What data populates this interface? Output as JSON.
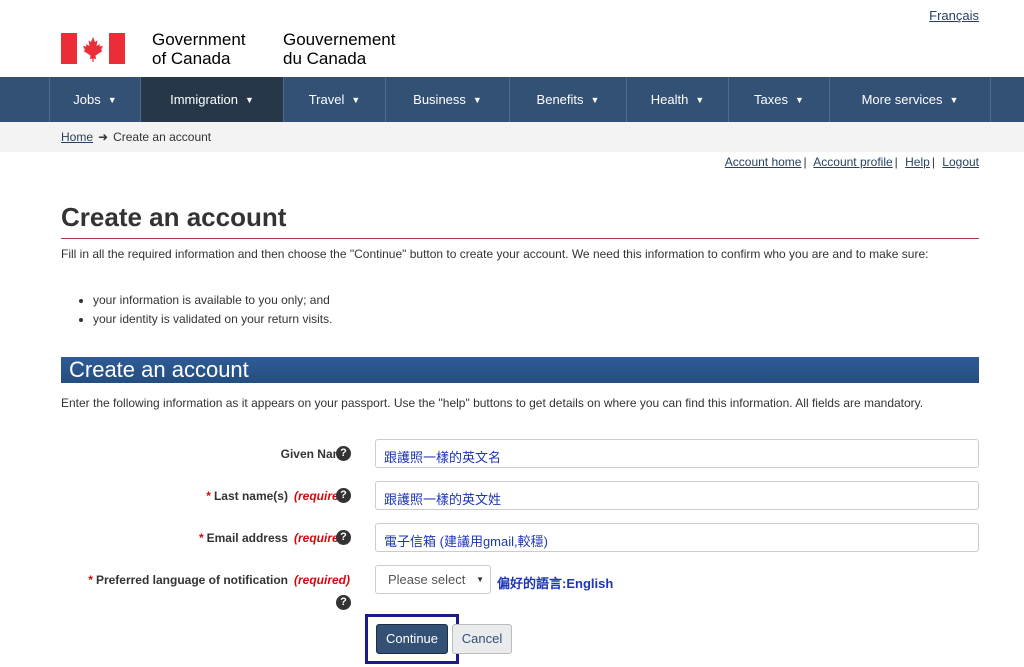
{
  "header": {
    "language_link": "Français",
    "gov_en_line1": "Government",
    "gov_en_line2": "of Canada",
    "gov_fr_line1": "Gouvernement",
    "gov_fr_line2": "du Canada"
  },
  "nav": {
    "items": [
      {
        "label": "Jobs"
      },
      {
        "label": "Immigration"
      },
      {
        "label": "Travel"
      },
      {
        "label": "Business"
      },
      {
        "label": "Benefits"
      },
      {
        "label": "Health"
      },
      {
        "label": "Taxes"
      },
      {
        "label": "More services"
      }
    ]
  },
  "breadcrumb": {
    "home": "Home",
    "current": "Create an account"
  },
  "account_links": {
    "home": "Account home",
    "profile": "Account profile",
    "help": "Help",
    "logout": "Logout",
    "separator": "|"
  },
  "page": {
    "title": "Create an account",
    "intro": "Fill in all the required information and then choose the \"Continue\" button to create your account. We need this information to confirm who you are and to make sure:",
    "bullets": [
      "your information is available to you only; and",
      "your identity is validated on your return visits."
    ]
  },
  "form": {
    "section_title": "Create an account",
    "section_intro": "Enter the following information as it appears on your passport. Use the \"help\" buttons to get details on where you can find this information. All fields are mandatory.",
    "required_marker": "*",
    "required_text": "(required)",
    "given_name": {
      "label": "Given Name",
      "value": "跟護照一樣的英文名"
    },
    "last_name": {
      "label": "Last name(s)",
      "value": "跟護照一樣的英文姓"
    },
    "email": {
      "label": "Email address",
      "value": "電子信箱 (建議用gmail,較穩)"
    },
    "language": {
      "label": "Preferred language of notification",
      "placeholder": "Please select",
      "annotation": "偏好的語言:English"
    },
    "continue_label": "Continue",
    "cancel_label": "Cancel"
  }
}
